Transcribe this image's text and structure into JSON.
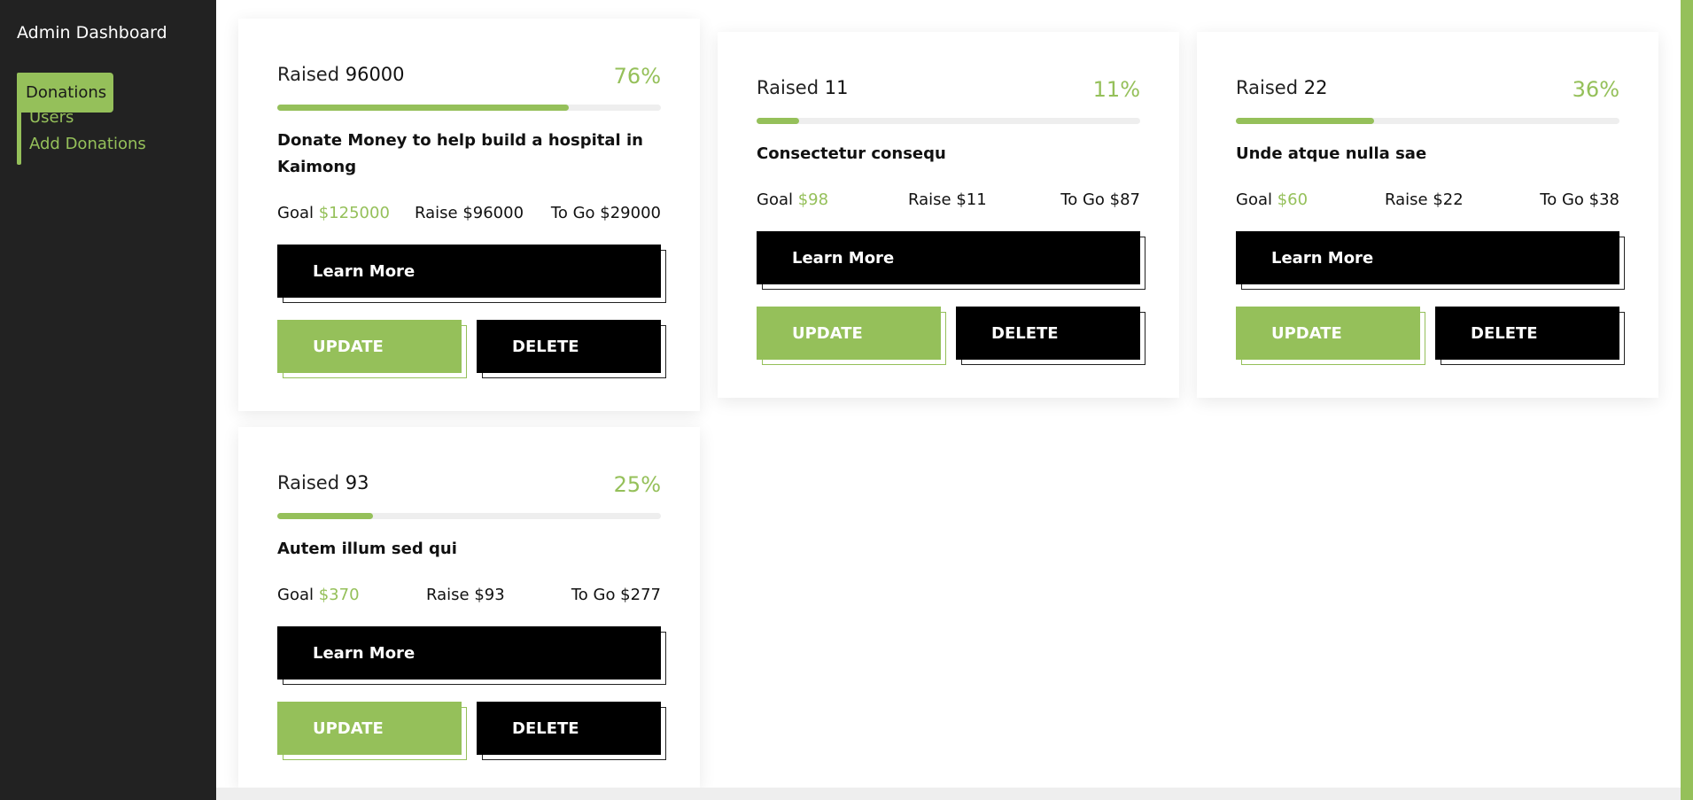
{
  "sidebar": {
    "title": "Admin Dashboard",
    "items": [
      {
        "label": "Donations",
        "active": true
      },
      {
        "label": "Users",
        "active": false
      },
      {
        "label": "Add Donations",
        "active": false
      }
    ]
  },
  "colors": {
    "accent": "#95c05a",
    "sidebar_bg": "#222222",
    "button_black": "#000000"
  },
  "cards": [
    {
      "raised_label": "Raised",
      "raised_value": "96000",
      "percent_text": "76%",
      "progress": 0.76,
      "title": "Donate Money to help build a hospital in Kaimong",
      "goal_label": "Goal",
      "goal_value": "$125000",
      "raise_text": "Raise $96000",
      "togo_text": "To Go $29000",
      "learn_more": "Learn More",
      "update": "UPDATE",
      "delete": "DELETE"
    },
    {
      "raised_label": "Raised",
      "raised_value": "11",
      "percent_text": "11%",
      "progress": 0.11,
      "title": "Consectetur consequ",
      "goal_label": "Goal",
      "goal_value": "$98",
      "raise_text": "Raise $11",
      "togo_text": "To Go $87",
      "learn_more": "Learn More",
      "update": "UPDATE",
      "delete": "DELETE"
    },
    {
      "raised_label": "Raised",
      "raised_value": "22",
      "percent_text": "36%",
      "progress": 0.36,
      "title": "Unde atque nulla sae",
      "goal_label": "Goal",
      "goal_value": "$60",
      "raise_text": "Raise $22",
      "togo_text": "To Go $38",
      "learn_more": "Learn More",
      "update": "UPDATE",
      "delete": "DELETE"
    },
    {
      "raised_label": "Raised",
      "raised_value": "93",
      "percent_text": "25%",
      "progress": 0.25,
      "title": "Autem illum sed qui",
      "goal_label": "Goal",
      "goal_value": "$370",
      "raise_text": "Raise $93",
      "togo_text": "To Go $277",
      "learn_more": "Learn More",
      "update": "UPDATE",
      "delete": "DELETE"
    }
  ]
}
